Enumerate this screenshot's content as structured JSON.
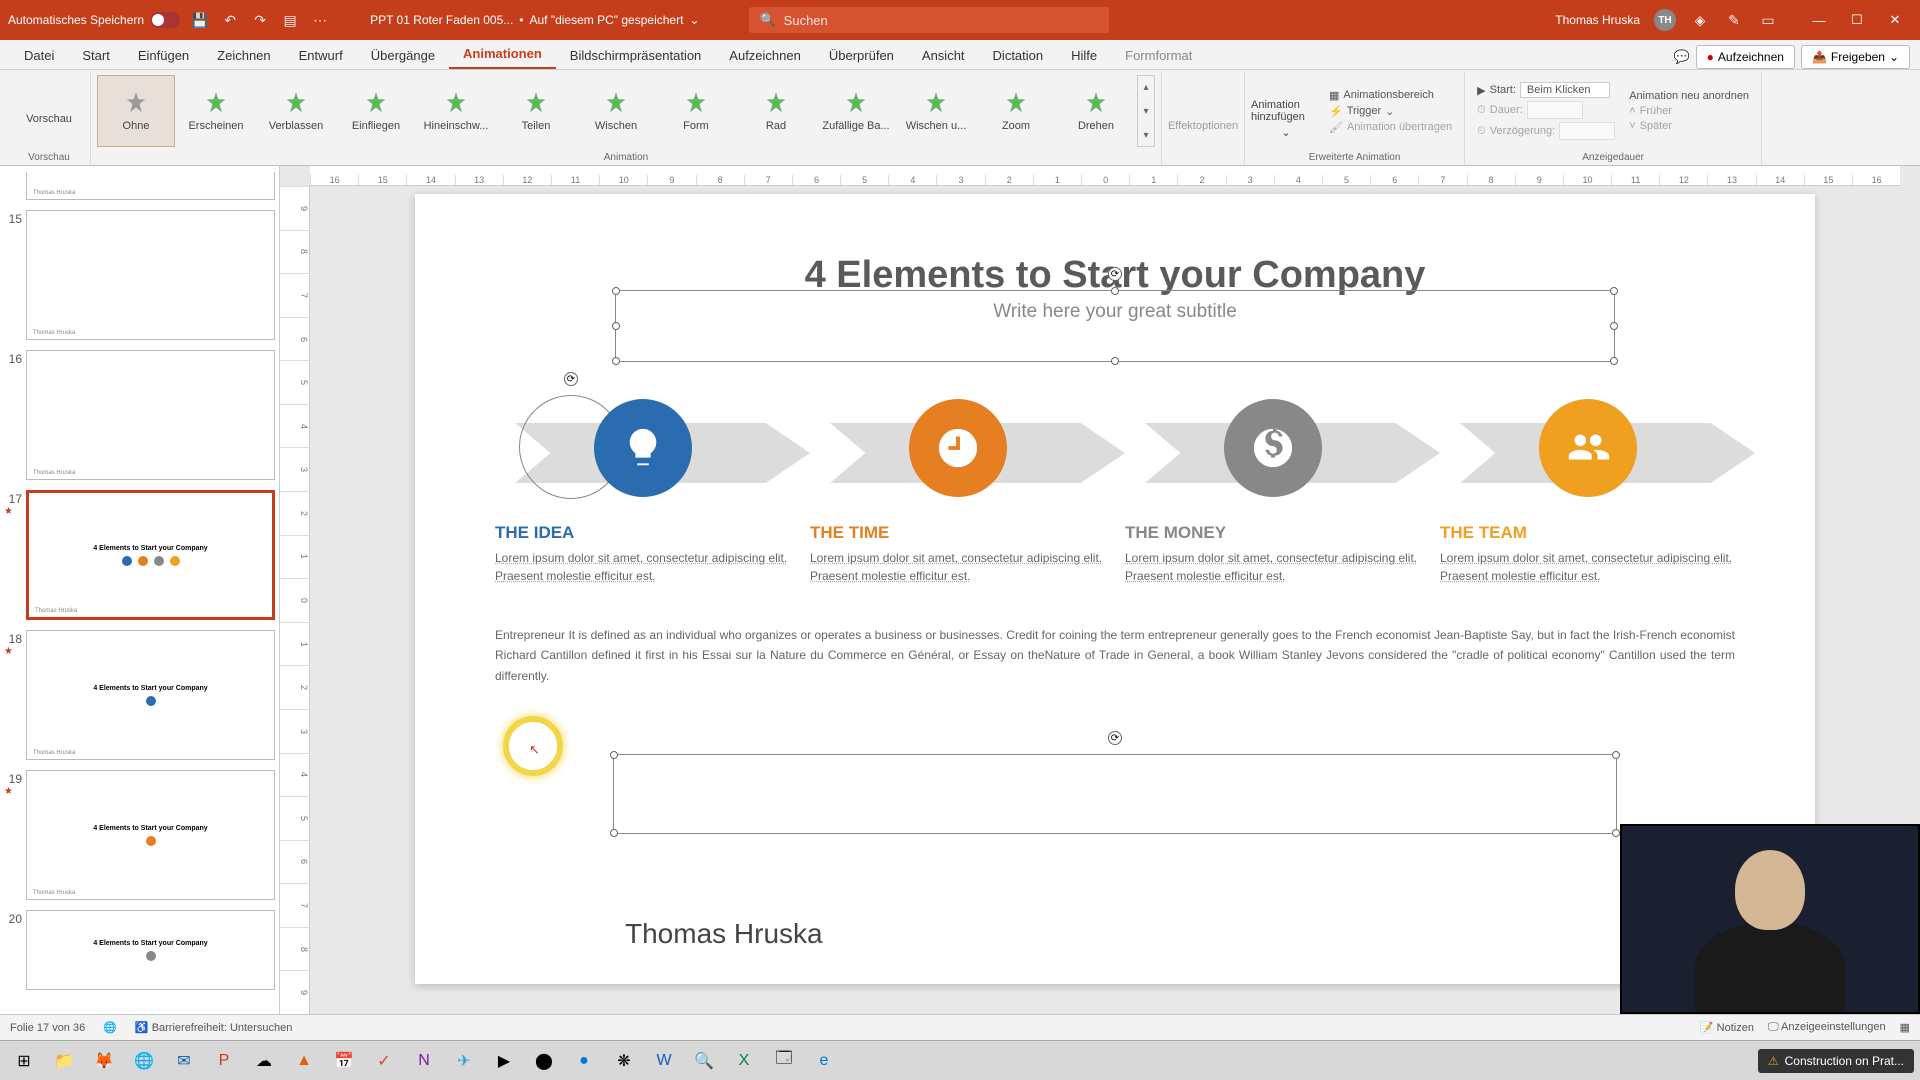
{
  "titlebar": {
    "autosave": "Automatisches Speichern",
    "filename": "PPT 01 Roter Faden 005...",
    "save_location": "Auf \"diesem PC\" gespeichert",
    "search_placeholder": "Suchen",
    "username": "Thomas Hruska",
    "user_initials": "TH"
  },
  "tabs": {
    "items": [
      "Datei",
      "Start",
      "Einfügen",
      "Zeichnen",
      "Entwurf",
      "Übergänge",
      "Animationen",
      "Bildschirmpräsentation",
      "Aufzeichnen",
      "Überprüfen",
      "Ansicht",
      "Dictation",
      "Hilfe",
      "Formformat"
    ],
    "active_index": 6,
    "record": "Aufzeichnen",
    "share": "Freigeben"
  },
  "ribbon": {
    "preview": "Vorschau",
    "preview_group": "Vorschau",
    "anims": [
      "Ohne",
      "Erscheinen",
      "Verblassen",
      "Einfliegen",
      "Hineinschw...",
      "Teilen",
      "Wischen",
      "Form",
      "Rad",
      "Zufällige Ba...",
      "Wischen u...",
      "Zoom",
      "Drehen"
    ],
    "effect_options": "Effektoptionen",
    "anim_group": "Animation",
    "add_anim": "Animation hinzufügen",
    "pane": "Animationsbereich",
    "trigger": "Trigger",
    "painter": "Animation übertragen",
    "ext_group": "Erweiterte Animation",
    "start_label": "Start:",
    "start_value": "Beim Klicken",
    "duration": "Dauer:",
    "delay": "Verzögerung:",
    "reorder": "Animation neu anordnen",
    "earlier": "Früher",
    "later": "Später",
    "timing_group": "Anzeigedauer"
  },
  "thumbs": {
    "nums": [
      "15",
      "16",
      "17",
      "18",
      "19",
      "20"
    ],
    "active_index": 2,
    "mini_title": "4 Elements to Start your Company",
    "footer": "Thomas Hruska"
  },
  "ruler": {
    "h": [
      "16",
      "15",
      "14",
      "13",
      "12",
      "11",
      "10",
      "9",
      "8",
      "7",
      "6",
      "5",
      "4",
      "3",
      "2",
      "1",
      "0",
      "1",
      "2",
      "3",
      "4",
      "5",
      "6",
      "7",
      "8",
      "9",
      "10",
      "11",
      "12",
      "13",
      "14",
      "15",
      "16"
    ],
    "v": [
      "9",
      "8",
      "7",
      "6",
      "5",
      "4",
      "3",
      "2",
      "1",
      "0",
      "1",
      "2",
      "3",
      "4",
      "5",
      "6",
      "7",
      "8",
      "9"
    ]
  },
  "slide": {
    "title": "4 Elements to Start your Company",
    "subtitle": "Write here your great subtitle",
    "cards": [
      {
        "heading": "THE IDEA",
        "body": "Lorem ipsum dolor sit amet, consectetur adipiscing elit. Praesent molestie efficitur est."
      },
      {
        "heading": "THE TIME",
        "body": "Lorem ipsum dolor sit amet, consectetur adipiscing elit. Praesent molestie efficitur est."
      },
      {
        "heading": "THE MONEY",
        "body": "Lorem ipsum dolor sit amet, consectetur adipiscing elit. Praesent molestie efficitur est."
      },
      {
        "heading": "THE TEAM",
        "body": "Lorem ipsum dolor sit amet, consectetur adipiscing elit. Praesent molestie efficitur est."
      }
    ],
    "paragraph": "Entrepreneur   It is defined as an individual who organizes or operates a business or businesses. Credit for coining the term entrepreneur generally goes to the French economist Jean-Baptiste Say, but in fact the Irish-French economist Richard Cantillon defined it first in his Essai sur la Nature du Commerce en Général, or Essay on theNature of Trade in General, a book William Stanley Jevons considered the \"cradle of political economy\" Cantillon used the term differently.",
    "author": "Thomas Hruska"
  },
  "statusbar": {
    "slide_of": "Folie 17 von 36",
    "a11y": "Barrierefreiheit: Untersuchen",
    "notes": "Notizen",
    "display": "Anzeigeeinstellungen"
  },
  "taskbar": {
    "notif": "Construction on Prat..."
  },
  "colors": {
    "accent": "#C43E1C"
  }
}
